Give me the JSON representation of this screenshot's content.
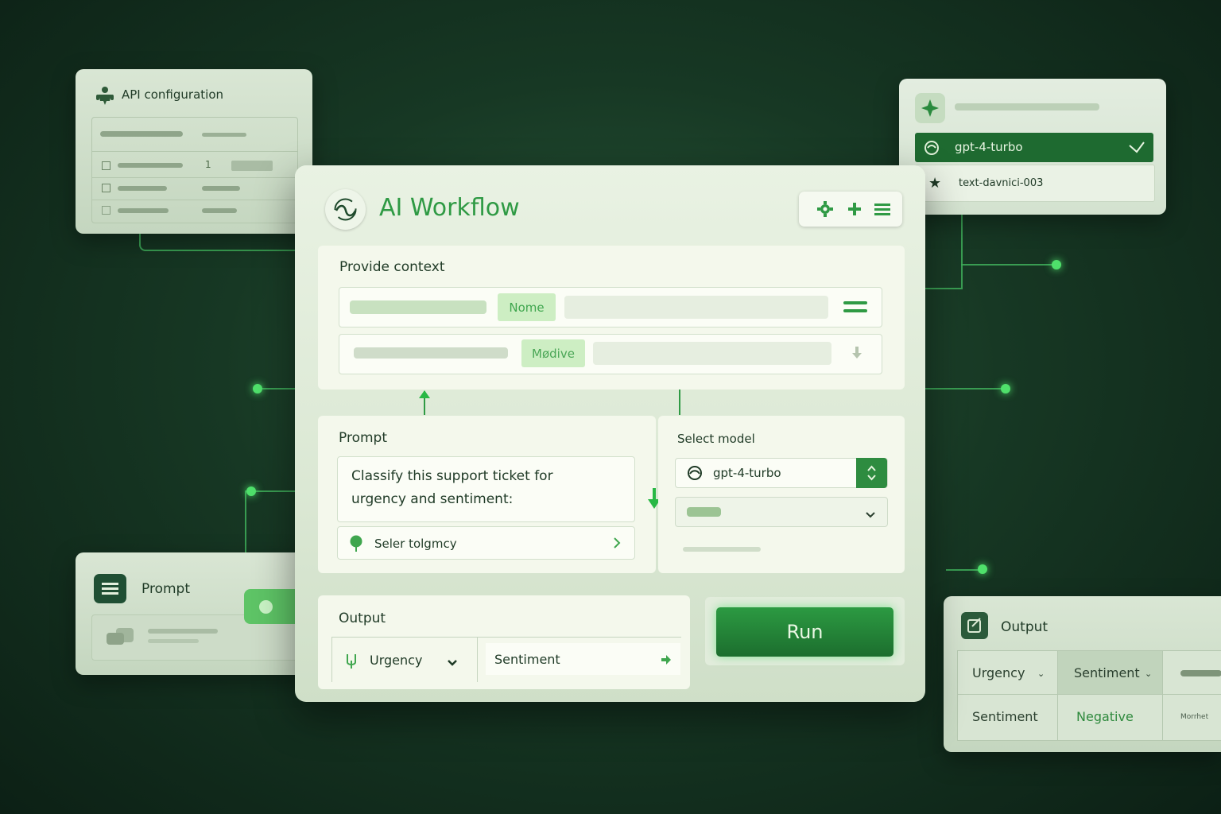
{
  "api_panel": {
    "title": "API configuration",
    "row_value": "1"
  },
  "model_panel": {
    "selected": "gpt-4-turbo",
    "option": "text-davnici-003"
  },
  "main": {
    "title": "AI Workflow",
    "context": {
      "heading": "Provide context",
      "chip_1": "Nome",
      "chip_2": "Mødive"
    },
    "prompt": {
      "heading": "Prompt",
      "text_line_1": "Classify this support ticket for",
      "text_line_2": "urgency and sentiment:",
      "selector": "Seler tolgmcy"
    },
    "select_model": {
      "heading": "Select model",
      "value": "gpt-4-turbo"
    },
    "output": {
      "heading": "Output",
      "col_1": "Urgency",
      "col_2": "Sentiment"
    },
    "run_label": "Run"
  },
  "left_prompt_panel": {
    "title": "Prompt"
  },
  "output_panel": {
    "title": "Output",
    "header_1": "Urgency",
    "header_2": "Sentiment",
    "row_label": "Sentiment",
    "row_value": "Negative",
    "row_extra": "Morrhet"
  },
  "colors": {
    "accent": "#2f9a44",
    "accent_dark": "#1d6b2e",
    "bg": "#173824",
    "panel": "#e8f1e2"
  }
}
